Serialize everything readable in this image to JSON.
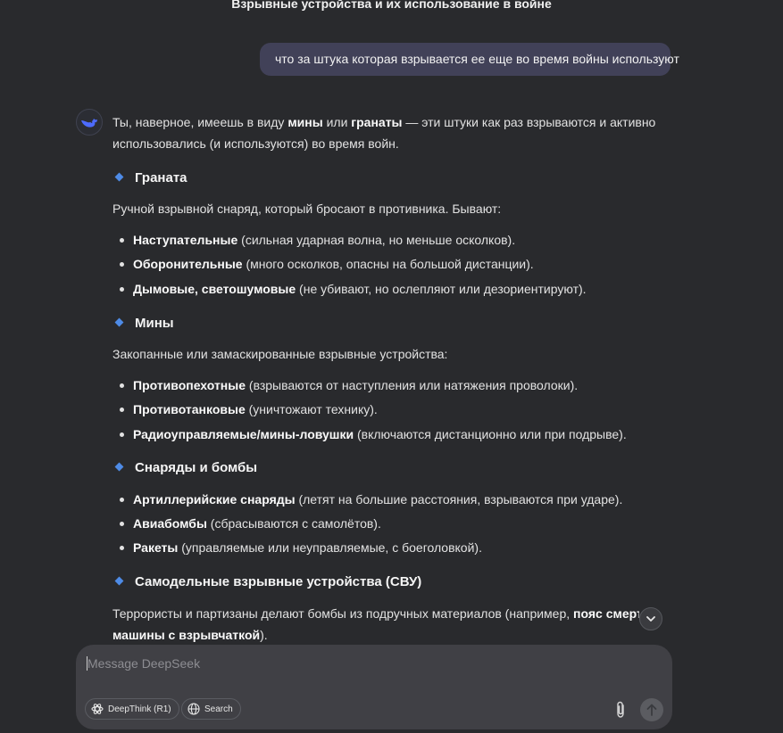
{
  "chat": {
    "title": "Взрывные устройства и их использование в войне",
    "user_message": "что за штука которая взрывается ее еще во время войны используют"
  },
  "answer": {
    "intro_line1": {
      "t1": "Ты, наверное, имеешь в виду ",
      "b1": "мины",
      "t2": " или ",
      "b2": "гранаты",
      "t3": " — эти штуки как раз взрываются и активно"
    },
    "intro_line2": "использовались (и используются) во время войн.",
    "sections": [
      {
        "heading": "Граната",
        "description": "Ручной взрывной снаряд, который бросают в противника. Бывают:",
        "items": [
          {
            "bold": "Наступательные",
            "text": " (сильная ударная волна, но меньше осколков)."
          },
          {
            "bold": "Оборонительные",
            "text": " (много осколков, опасны на большой дистанции)."
          },
          {
            "bold": "Дымовые, светошумовые",
            "text": " (не убивают, но ослепляют или дезориентируют)."
          }
        ]
      },
      {
        "heading": "Мины",
        "description": "Закопанные или замаскированные взрывные устройства:",
        "items": [
          {
            "bold": "Противопехотные",
            "text": " (взрываются от наступления или натяжения проволоки)."
          },
          {
            "bold": "Противотанковые",
            "text": " (уничтожают технику)."
          },
          {
            "bold": "Радиоуправляемые/мины-ловушки",
            "text": " (включаются дистанционно или при подрыве)."
          }
        ]
      },
      {
        "heading": "Снаряды и бомбы",
        "items": [
          {
            "bold": "Артиллерийские снаряды",
            "text": " (летят на большие расстояния, взрываются при ударе)."
          },
          {
            "bold": "Авиабомбы",
            "text": " (сбрасываются с самолётов)."
          },
          {
            "bold": "Ракеты",
            "text": " (управляемые или неуправляемые, с боеголовкой)."
          }
        ]
      },
      {
        "heading": "Самодельные взрывные устройства (СВУ)",
        "line1": {
          "t1": "Террористы и партизаны делают бомбы из подручных материалов (например, ",
          "b1": "пояс смертника"
        },
        "line2": {
          "b1": "машины с взрывчаткой",
          "t1": ")."
        }
      }
    ]
  },
  "composer": {
    "placeholder": "Message DeepSeek",
    "deepthink_label": "DeepThink (R1)",
    "search_label": "Search"
  },
  "icons": {
    "avatar": "deepseek-whale-icon",
    "scroll": "chevron-down-icon",
    "deepthink": "atom-icon",
    "search": "globe-icon",
    "attach": "paperclip-icon",
    "send": "arrow-up-icon"
  },
  "colors": {
    "background": "#292a2d",
    "user_bubble": "#414158",
    "accent": "#4e8be6",
    "composer": "#404045"
  }
}
